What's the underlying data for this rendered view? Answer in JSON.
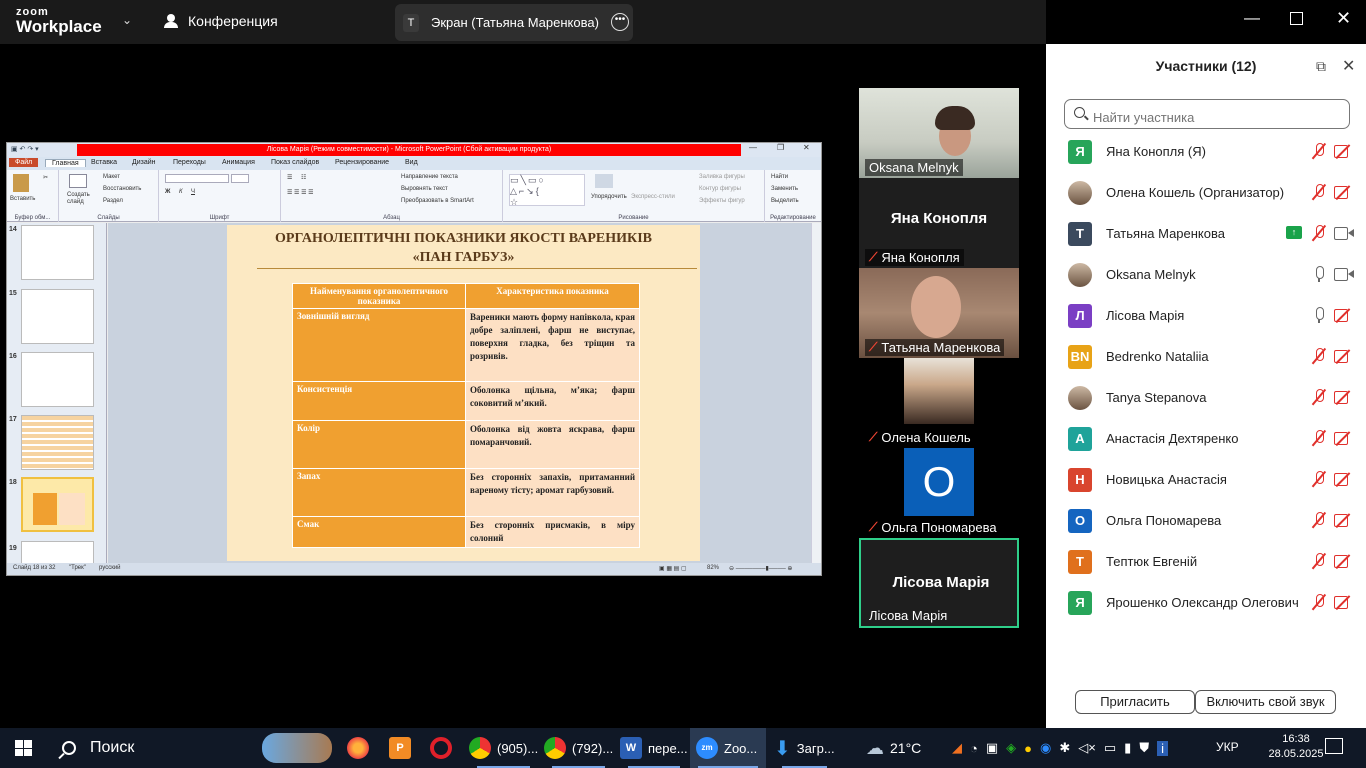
{
  "topbar": {
    "logo_line1": "zoom",
    "logo_line2": "Workplace",
    "meeting_label": "Конференция",
    "share_badge": "T",
    "share_label": "Экран (Татьяна Маренкова)"
  },
  "ppt": {
    "window_title": "Лісова Марія (Режим совместимости) - Microsoft PowerPoint (Сбой активации продукта)",
    "tabs": [
      "Файл",
      "Главная",
      "Вставка",
      "Дизайн",
      "Переходы",
      "Анимация",
      "Показ слайдов",
      "Рецензирование",
      "Вид"
    ],
    "ribbon": {
      "paste": "Вставить",
      "layout": "Макет",
      "reset": "Восстановить",
      "section": "Раздел",
      "new_slide": "Создать слайд",
      "group_clipboard": "Буфер обм...",
      "group_slides": "Слайды",
      "group_font": "Шрифт",
      "group_paragraph": "Абзац",
      "text_direction": "Направление текста",
      "align_text": "Выровнять текст",
      "smartart": "Преобразовать в SmartArt",
      "arrange": "Упорядочить",
      "quick_styles": "Экспресс-стили",
      "shape_fill": "Заливка фигуры",
      "shape_outline": "Контур фигуры",
      "shape_effects": "Эффекты фигур",
      "group_drawing": "Рисование",
      "find": "Найти",
      "replace": "Заменить",
      "select": "Выделить",
      "group_editing": "Редактирование"
    },
    "thumb_numbers": [
      "14",
      "15",
      "16",
      "17",
      "18",
      "19"
    ],
    "slide": {
      "title_line1": "ОРГАНОЛЕПТИЧНІ ПОКАЗНИКИ ЯКОСТІ ВАРЕНИКІВ",
      "title_line2": "«ПАН ГАРБУЗ»",
      "header_col1": "Найменування органолептичного показника",
      "header_col2": "Характеристика показника",
      "rows": [
        {
          "k": "Зовнішній вигляд",
          "v": "Вареники мають форму напівкола, края добре заліплені, фарш не виступає, поверхня гладка, без тріщин та розривів."
        },
        {
          "k": "Консистенція",
          "v": "Оболонка щільна, м’яка; фарш соковитий м’який."
        },
        {
          "k": "Колір",
          "v": "Оболонка від жовта яскрава, фарш помаранчовий."
        },
        {
          "k": "Запах",
          "v": "Без сторонніх запахів, притаманний вареному тісту; аромат гарбузовий."
        },
        {
          "k": "Смак",
          "v": "Без сторонніх присмаків, в міру солоний"
        }
      ]
    },
    "status": {
      "slide_info": "Слайд 18 из 32",
      "theme": "\"Трек\"",
      "language": "русский",
      "zoom": "82%"
    }
  },
  "tiles": {
    "oksana": "Oksana Melnyk",
    "yana_big": "Яна Конопля",
    "yana": "Яна Конопля",
    "tatyana": "Татьяна Маренкова",
    "olena": "Олена Кошель",
    "olga_letter": "О",
    "olga": "Ольга Пономарева",
    "lisova_big": "Лісова Марія",
    "lisova": "Лісова Марія"
  },
  "panel": {
    "title": "Участники (12)",
    "search_placeholder": "Найти участника",
    "participants": [
      {
        "initials": "Я",
        "color": "#27a55a",
        "name": "Яна Конопля (Я)",
        "mic": "off",
        "cam": "off"
      },
      {
        "initials": "",
        "color": "photo",
        "name": "Олена Кошель (Организатор)",
        "mic": "off",
        "cam": "off"
      },
      {
        "initials": "T",
        "color": "#3b4a5e",
        "name": "Татьяна Маренкова",
        "mic": "off",
        "cam": "on",
        "sharing": true
      },
      {
        "initials": "",
        "color": "photo",
        "name": "Oksana Melnyk",
        "mic": "on",
        "cam": "on"
      },
      {
        "initials": "Л",
        "color": "#7b3fc4",
        "name": "Лісова Марія",
        "mic": "on",
        "cam": "off"
      },
      {
        "initials": "BN",
        "color": "#e8a317",
        "name": "Bedrenko Nataliia",
        "mic": "off",
        "cam": "off"
      },
      {
        "initials": "",
        "color": "photo",
        "name": "Tanya Stepanova",
        "mic": "off",
        "cam": "off"
      },
      {
        "initials": "А",
        "color": "#1fa39a",
        "name": "Анастасія Дехтяренко",
        "mic": "off",
        "cam": "off"
      },
      {
        "initials": "Н",
        "color": "#d9452e",
        "name": "Новицька Анастасія",
        "mic": "off",
        "cam": "off"
      },
      {
        "initials": "О",
        "color": "#1565c0",
        "name": "Ольга Пономарева",
        "mic": "off",
        "cam": "off"
      },
      {
        "initials": "T",
        "color": "#e0701d",
        "name": "Тептюк Евгеній",
        "mic": "off",
        "cam": "off"
      },
      {
        "initials": "Я",
        "color": "#27a55a",
        "name": "Ярошенко Олександр Олегович",
        "mic": "off",
        "cam": "off"
      }
    ],
    "invite": "Пригласить",
    "unmute": "Включить свой звук"
  },
  "taskbar": {
    "search": "Поиск",
    "apps": [
      "(905)...",
      "(792)...",
      "пере...",
      "Zoo...",
      "Загр..."
    ],
    "weather": "21°C",
    "lang": "УКР",
    "time": "16:38",
    "date": "28.05.2025"
  }
}
